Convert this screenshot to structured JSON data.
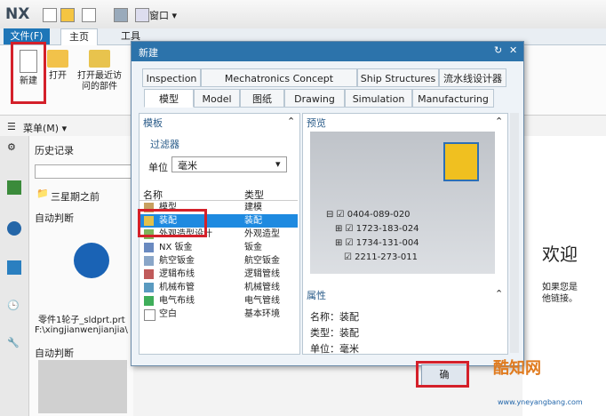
{
  "app": {
    "logo": "NX",
    "window_menu": "窗口 ▾"
  },
  "ribbon": {
    "tabs": [
      "文件(F)",
      "主页",
      "工具"
    ],
    "buttons": {
      "new": "新建",
      "open": "打开",
      "open_recent_line1": "打开最近访",
      "open_recent_line2": "问的部件"
    },
    "menu": "菜单(M) ▾"
  },
  "history": {
    "title": "历史记录",
    "group": "三星期之前",
    "auto": "自动判断",
    "file_name": "零件1轮子_sldprt.prt",
    "file_path": "F:\\xingjianwenjianjia\\",
    "auto2": "自动判断"
  },
  "welcome": {
    "title": "欢迎",
    "line1": "如果您是",
    "line2": "他链接。"
  },
  "dialog": {
    "title": "新建",
    "tabs_row1": [
      "Inspection",
      "Mechatronics Concept Designer",
      "Ship Structures",
      "流水线设计器"
    ],
    "tabs_row2": [
      "模型",
      "Model",
      "图纸",
      "Drawing",
      "Simulation",
      "Manufacturing"
    ],
    "template_header": "模板",
    "filter_header": "过滤器",
    "unit_label": "单位",
    "unit_value": "毫米",
    "columns": [
      "名称",
      "类型"
    ],
    "rows": [
      {
        "name": "模型",
        "type": "建模"
      },
      {
        "name": "装配",
        "type": "装配"
      },
      {
        "name": "外观造型设计",
        "type": "外观造型"
      },
      {
        "name": "NX 钣金",
        "type": "钣金"
      },
      {
        "name": "航空钣金",
        "type": "航空钣金"
      },
      {
        "name": "逻辑布线",
        "type": "逻辑管线"
      },
      {
        "name": "机械布管",
        "type": "机械管线"
      },
      {
        "name": "电气布线",
        "type": "电气管线"
      },
      {
        "name": "空白",
        "type": "基本环境"
      }
    ],
    "preview_header": "预览",
    "tree": [
      "0404-089-020",
      "1723-183-024",
      "1734-131-004",
      "2211-273-011"
    ],
    "props_header": "属性",
    "props": {
      "name_label": "名称：",
      "name": "装配",
      "type_label": "类型：",
      "type": "装配",
      "unit_label": "单位：",
      "unit": "毫米"
    },
    "ok": "确"
  },
  "watermark": {
    "line1": "酷知网",
    "line2": "www.yneyangbang.com"
  },
  "colors": {
    "accent": "#2c73ab",
    "highlight": "#d4202a",
    "selection": "#1e8ae0"
  }
}
